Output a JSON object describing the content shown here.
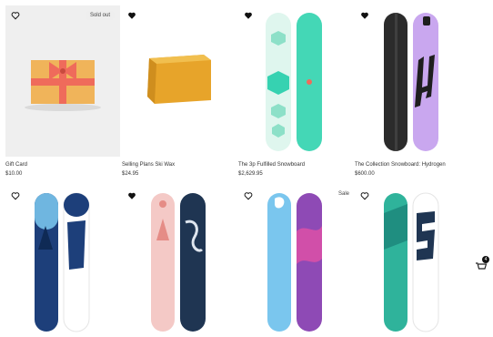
{
  "products": [
    {
      "name": "Gift Card",
      "price": "$10.00",
      "badge": "Sold out"
    },
    {
      "name": "Selling Plans Ski Wax",
      "price": "$24.95"
    },
    {
      "name": "The 3p Fulfilled Snowboard",
      "price": "$2,629.95"
    },
    {
      "name": "The Collection Snowboard: Hydrogen",
      "price": "$600.00"
    },
    {
      "name": "",
      "price": ""
    },
    {
      "name": "",
      "price": ""
    },
    {
      "name": "",
      "price": "",
      "badge": "Sale"
    },
    {
      "name": "",
      "price": ""
    }
  ],
  "cart": {
    "count": "4"
  },
  "colors": {
    "accent": "#44d7b6",
    "purple": "#c9a7ef",
    "wax": "#e8a72a"
  }
}
